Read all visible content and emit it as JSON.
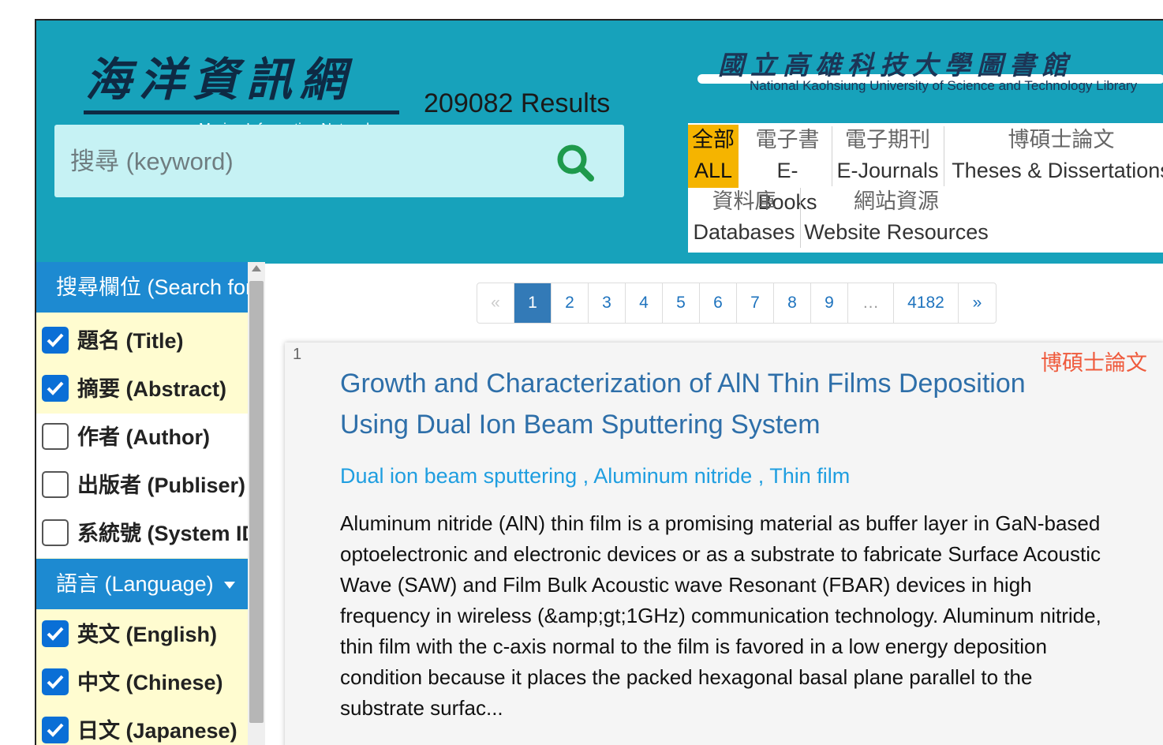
{
  "header": {
    "logo_cn": "海洋資訊網",
    "logo_en": "Marine Information Network",
    "results": "209082 Results",
    "library_cn": "國立高雄科技大學圖書館",
    "library_en": "National Kaohsiung University of Science and Technology Library",
    "accent_color": "#17a2bb"
  },
  "search": {
    "placeholder": "搜尋 (keyword)",
    "icon": "search-icon"
  },
  "categories": [
    {
      "cn": "全部",
      "en": "ALL",
      "active": true
    },
    {
      "cn": "電子書",
      "en": "E-Books",
      "active": false
    },
    {
      "cn": "電子期刊",
      "en": "E-Journals",
      "active": false
    },
    {
      "cn": "博碩士論文",
      "en": "Theses & Dissertations",
      "active": false
    },
    {
      "cn": "資料庫",
      "en": "Databases",
      "active": false
    },
    {
      "cn": "網站資源",
      "en": "Website Resources",
      "active": false
    }
  ],
  "sidebar": {
    "search_for_header": "搜尋欄位 (Search for",
    "fields": [
      {
        "label": "題名 (Title)",
        "checked": true
      },
      {
        "label": "摘要 (Abstract)",
        "checked": true
      },
      {
        "label": "作者 (Author)",
        "checked": false
      },
      {
        "label": "出版者 (Publiser)",
        "checked": false
      },
      {
        "label": "系統號 (System ID",
        "checked": false
      }
    ],
    "language_header": "語言 (Language)",
    "languages": [
      {
        "label": "英文 (English)",
        "checked": true
      },
      {
        "label": "中文 (Chinese)",
        "checked": true
      },
      {
        "label": "日文 (Japanese)",
        "checked": true
      }
    ]
  },
  "pagination": {
    "prev": "«",
    "pages": [
      "1",
      "2",
      "3",
      "4",
      "5",
      "6",
      "7",
      "8",
      "9",
      "…",
      "4182"
    ],
    "current": "1",
    "next": "»"
  },
  "result": {
    "index": "1",
    "type": "博碩士論文",
    "title": "Growth and Characterization of AlN Thin Films Deposition Using Dual Ion Beam Sputtering System",
    "keywords": "Dual ion beam sputtering , Aluminum nitride , Thin film",
    "abstract": "Aluminum nitride (AlN) thin film is a promising material as buffer layer in GaN-based optoelectronic and electronic devices or as a substrate to fabricate Surface Acoustic Wave (SAW) and Film Bulk Acoustic wave Resonant (FBAR) devices in high frequency in wireless (&amp;gt;1GHz) communication technology. Aluminum nitride, thin film with the c-axis normal to the film is favored in a low energy deposition condition because it places the packed hexagonal basal plane parallel to the substrate surfac..."
  }
}
